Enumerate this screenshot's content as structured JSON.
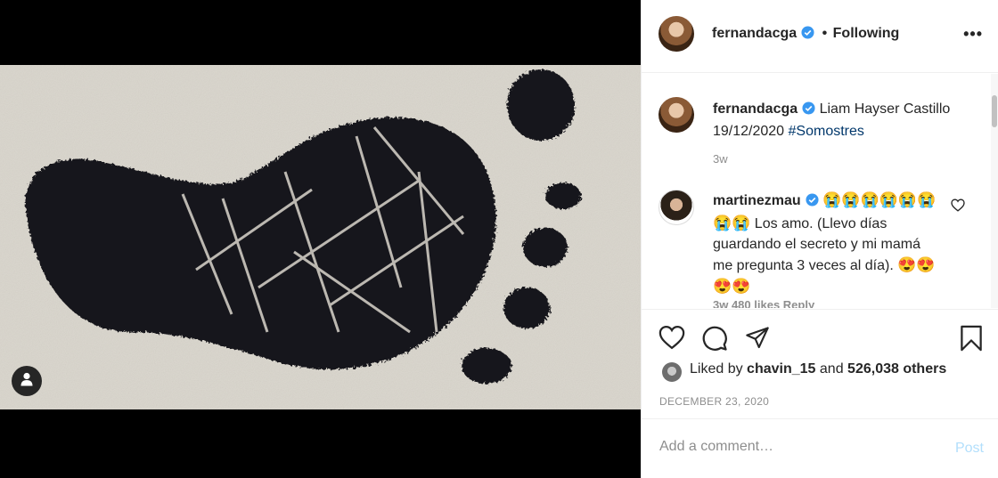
{
  "post": {
    "image_alt": "footprint",
    "tag_icon": "user-icon"
  },
  "header": {
    "username": "fernandacga",
    "separator": "•",
    "follow_label": "Following",
    "more_icon": "more-icon",
    "more_label": "•••"
  },
  "caption": {
    "username": "fernandacga",
    "text": "Liam Hayser Castillo 19/12/2020",
    "hashtag": "#Somostres",
    "time": "3w"
  },
  "comments": [
    {
      "username": "martinezmau",
      "emojis_before": "😭😭😭😭😭😭😭😭",
      "text": "Los amo. (Llevo días guardando el secreto y mi mamá me pregunta 3 veces al día).",
      "emojis_after": "😍😍😍😍",
      "meta": "3w   480 likes   Reply"
    }
  ],
  "actions": {
    "like_icon": "heart-icon",
    "comment_icon": "comment-icon",
    "share_icon": "share-icon",
    "save_icon": "bookmark-icon"
  },
  "likes": {
    "prefix": "Liked by",
    "user": "chavin_15",
    "middle": "and",
    "count": "526,038 others"
  },
  "date": "DECEMBER 23, 2020",
  "add_comment": {
    "placeholder": "Add a comment…",
    "post_label": "Post"
  },
  "colors": {
    "verified": "#3897f0",
    "hashtag": "#00376b",
    "post_disabled": "#b2dffc",
    "muted": "#8e8e8e"
  }
}
